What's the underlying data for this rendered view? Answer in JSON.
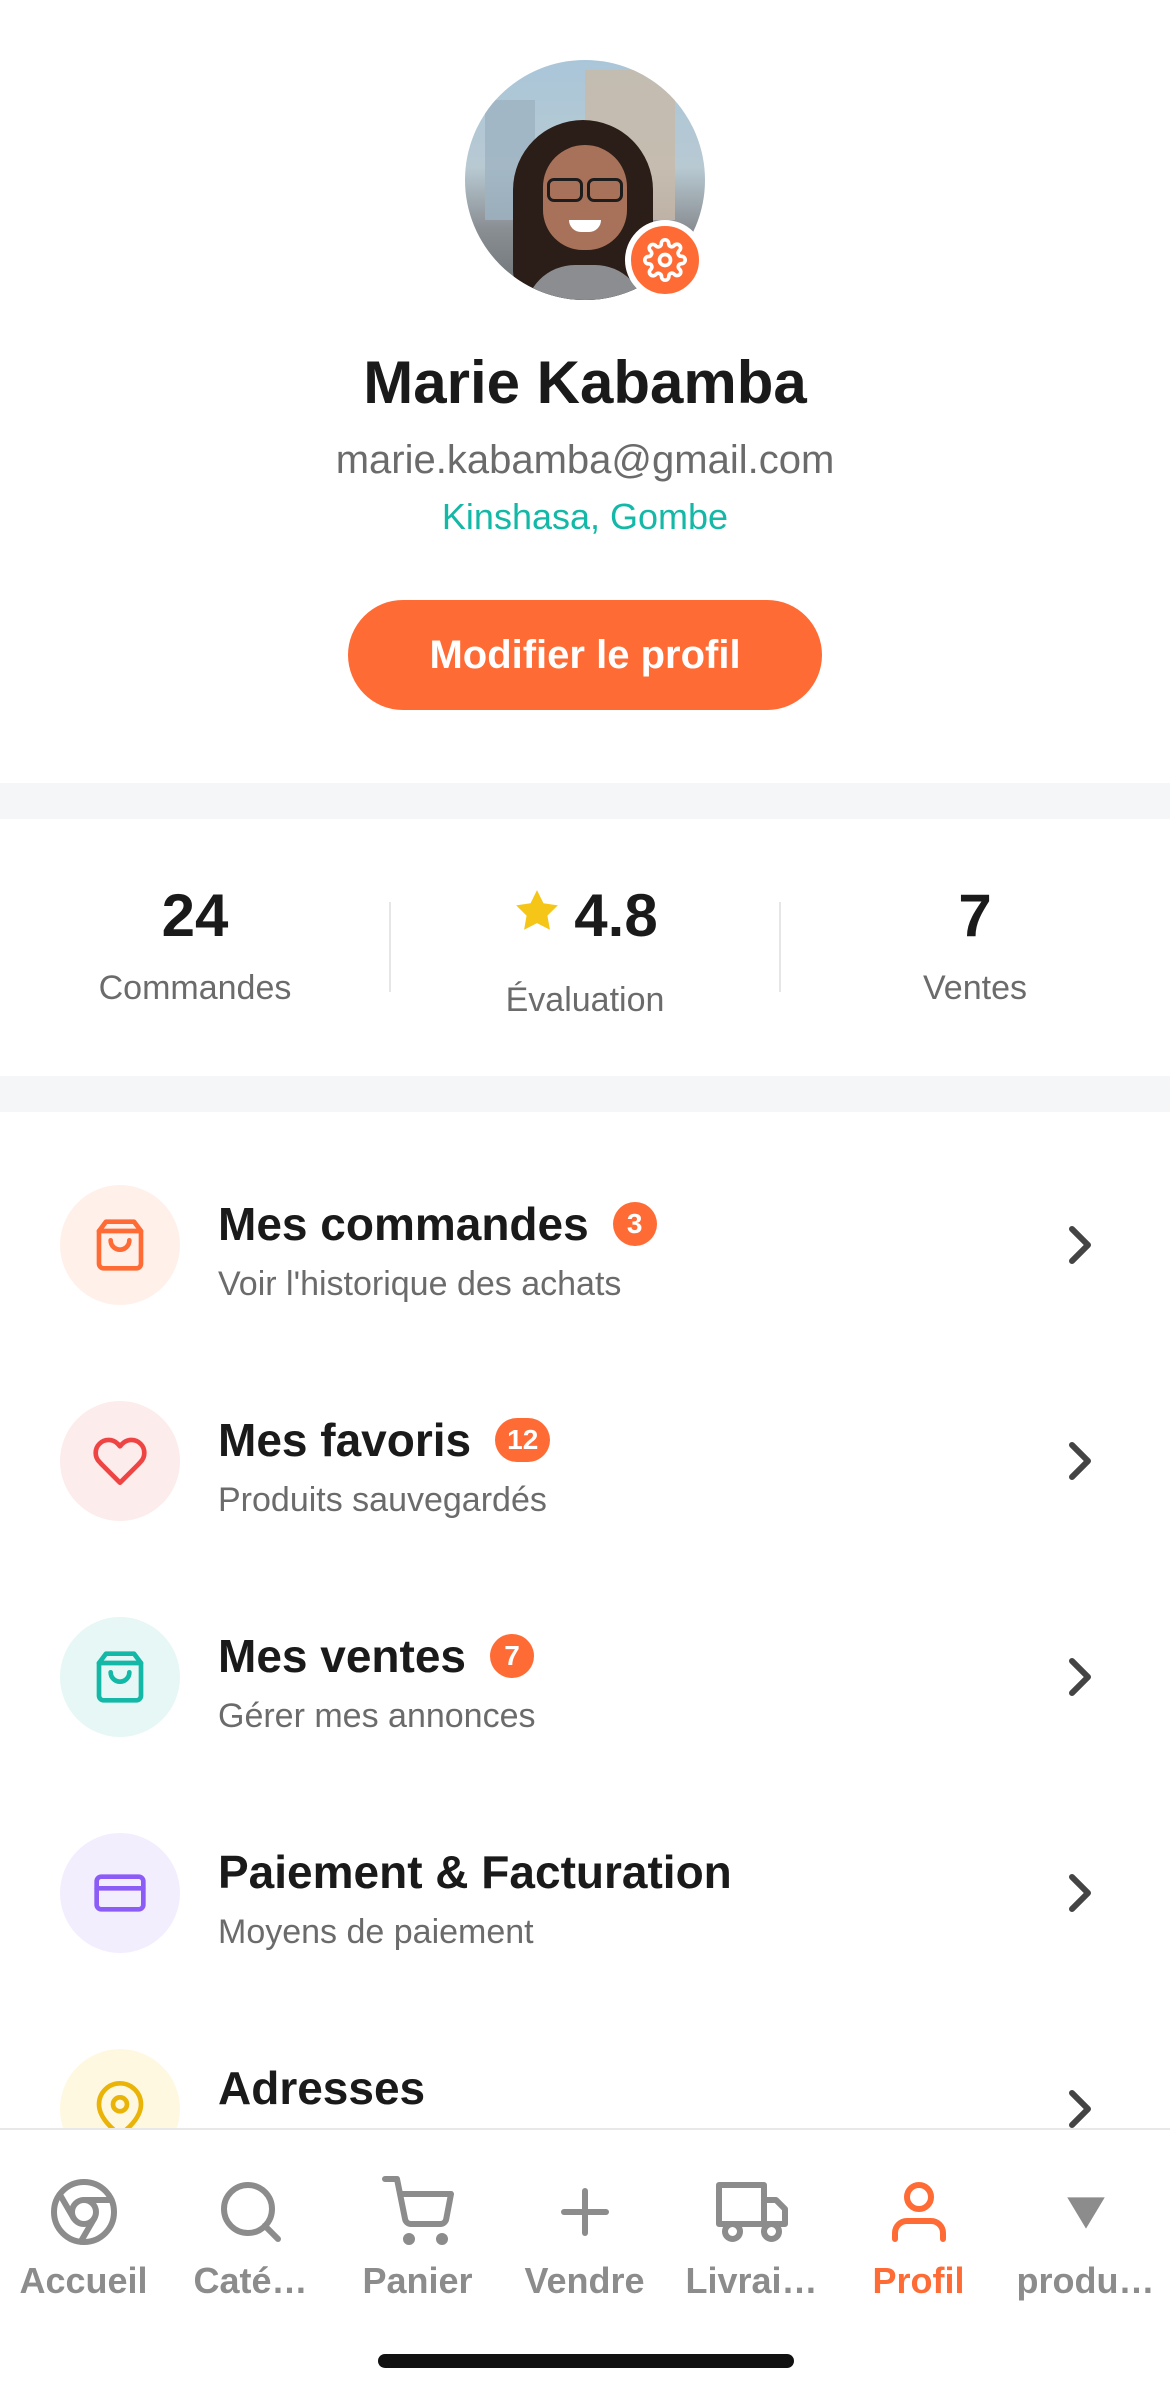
{
  "profile": {
    "name": "Marie Kabamba",
    "email": "marie.kabamba@gmail.com",
    "location": "Kinshasa, Gombe",
    "edit_button": "Modifier le profil"
  },
  "stats": [
    {
      "value": "24",
      "label": "Commandes"
    },
    {
      "value": "4.8",
      "label": "Évaluation",
      "icon": "star-icon"
    },
    {
      "value": "7",
      "label": "Ventes"
    }
  ],
  "menu": [
    {
      "title": "Mes commandes",
      "badge": "3",
      "subtitle": "Voir l'historique des achats",
      "icon": "shopping-bag-icon",
      "color": "#ff6b35",
      "bg": "#fff1ea"
    },
    {
      "title": "Mes favoris",
      "badge": "12",
      "subtitle": "Produits sauvegardés",
      "icon": "heart-icon",
      "color": "#ef4444",
      "bg": "#fdecec"
    },
    {
      "title": "Mes ventes",
      "badge": "7",
      "subtitle": "Gérer mes annonces",
      "icon": "shopping-bag-icon",
      "color": "#14b8a6",
      "bg": "#e6f7f5"
    },
    {
      "title": "Paiement & Facturation",
      "subtitle": "Moyens de paiement",
      "icon": "credit-card-icon",
      "color": "#8b5cf6",
      "bg": "#f3eefe"
    },
    {
      "title": "Adresses",
      "icon": "map-pin-icon",
      "color": "#eab308",
      "bg": "#fff8e1"
    }
  ],
  "nav": [
    {
      "label": "Accueil",
      "icon": "chrome-icon"
    },
    {
      "label": "Caté…",
      "icon": "search-icon"
    },
    {
      "label": "Panier",
      "icon": "cart-icon"
    },
    {
      "label": "Vendre",
      "icon": "plus-icon"
    },
    {
      "label": "Livrai…",
      "icon": "truck-icon"
    },
    {
      "label": "Profil",
      "icon": "user-icon",
      "active": true
    },
    {
      "label": "produ…",
      "icon": "triangle-down-icon"
    }
  ],
  "colors": {
    "accent": "#ff6b35",
    "teal": "#14b8a6",
    "muted": "#8c8c8c"
  }
}
